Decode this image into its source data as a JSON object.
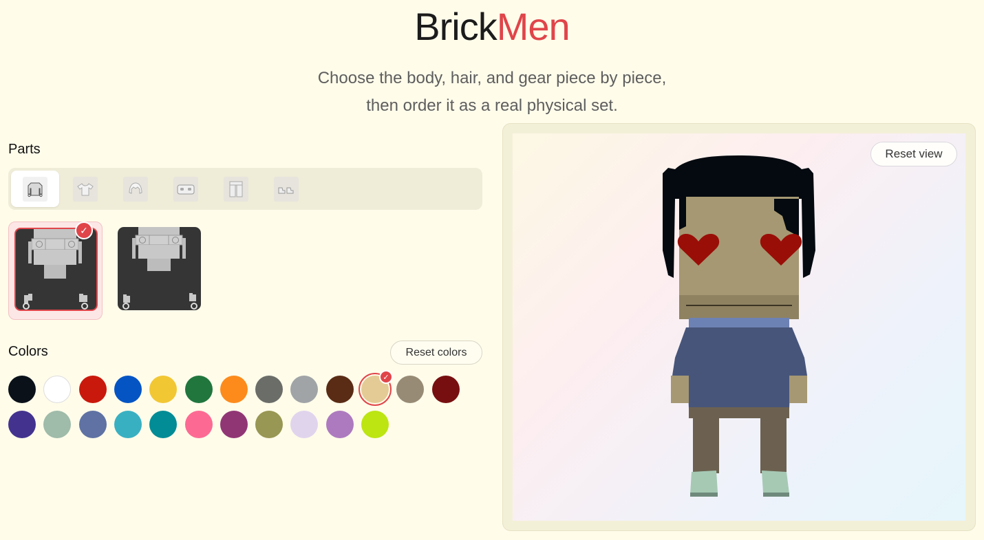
{
  "header": {
    "title_part1": "Brick",
    "title_part2": "Men",
    "subtitle_line1": "Choose the body, hair, and gear piece by piece,",
    "subtitle_line2": "then order it as a real physical set."
  },
  "parts": {
    "label": "Parts",
    "tabs": [
      {
        "icon": "torso-icon",
        "active": true
      },
      {
        "icon": "shirt-icon",
        "active": false
      },
      {
        "icon": "hair-icon",
        "active": false
      },
      {
        "icon": "face-icon",
        "active": false
      },
      {
        "icon": "legs-icon",
        "active": false
      },
      {
        "icon": "shoes-icon",
        "active": false
      }
    ],
    "options": [
      {
        "name": "torso-option-1",
        "selected": true
      },
      {
        "name": "torso-option-2",
        "selected": false
      }
    ]
  },
  "colors": {
    "label": "Colors",
    "reset_label": "Reset colors",
    "swatches": [
      "#0a1119",
      "#ffffff",
      "#c9190c",
      "#0454c4",
      "#f2c734",
      "#21763e",
      "#fc8b1c",
      "#6b6d69",
      "#a0a4a6",
      "#5a2c15",
      "#e4cb95",
      "#978b75",
      "#770f10",
      "#43338f",
      "#9fbba9",
      "#5f72a3",
      "#39b0c2",
      "#028c95",
      "#fc6a93",
      "#913675",
      "#989753",
      "#e0d4ed",
      "#ad7abf",
      "#bce512"
    ],
    "selected": "#e4cb95"
  },
  "viewer": {
    "reset_label": "Reset view",
    "colors": {
      "hair": "#040a10",
      "skin": "#a69872",
      "skin_dark": "#8f8261",
      "eyes": "#9a0e08",
      "torso": "#47557a",
      "collar": "#6d82b4",
      "legs": "#6c6150",
      "shoes": "#a6c9b4"
    }
  }
}
